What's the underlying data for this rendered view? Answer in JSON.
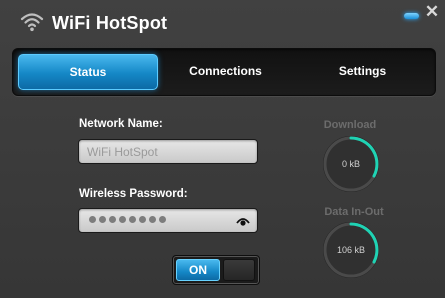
{
  "app": {
    "title": "WiFi HotSpot",
    "icon": "wifi-icon",
    "window_controls": {
      "minimize_icon": "minimize-icon",
      "close": "✕"
    }
  },
  "tabs": [
    {
      "label": "Status",
      "active": true
    },
    {
      "label": "Connections",
      "active": false
    },
    {
      "label": "Settings",
      "active": false
    }
  ],
  "form": {
    "network_name_label": "Network Name:",
    "network_name_value": "WiFi HotSpot",
    "password_label": "Wireless Password:",
    "password_masked": true,
    "password_length": 8,
    "show_password_icon": "eye-icon"
  },
  "toggle": {
    "label": "ON",
    "state": "on"
  },
  "stats": {
    "download": {
      "title": "Download",
      "value": "0 kB"
    },
    "data_in_out": {
      "title": "Data In-Out",
      "value": "106 kB"
    }
  },
  "colors": {
    "accent": "#1a9ae0",
    "gauge_arc": "#1fd3b4",
    "background": "#3b3b3b"
  }
}
